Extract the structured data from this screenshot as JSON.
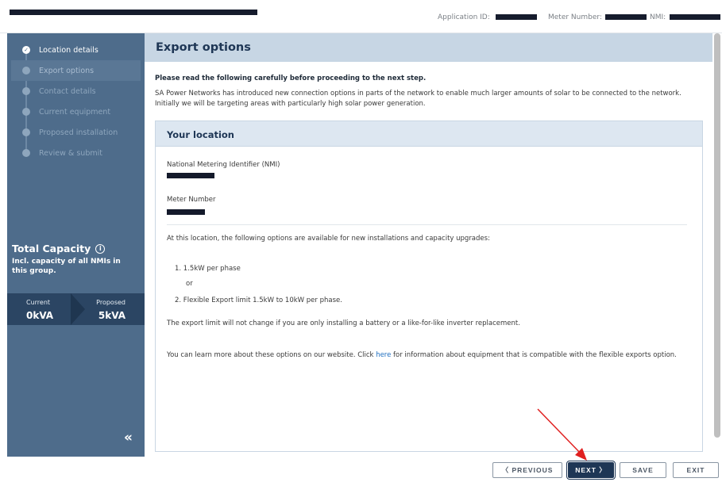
{
  "header": {
    "application_id_label": "Application ID:",
    "meter_number_label": "Meter Number:",
    "nmi_label": "NMI:"
  },
  "sidebar": {
    "steps": [
      {
        "label": "Location details",
        "state": "complete"
      },
      {
        "label": "Export options",
        "state": "current"
      },
      {
        "label": "Contact details",
        "state": "pending"
      },
      {
        "label": "Current equipment",
        "state": "pending"
      },
      {
        "label": "Proposed installation",
        "state": "pending"
      },
      {
        "label": "Review & submit",
        "state": "pending"
      }
    ],
    "capacity": {
      "title": "Total Capacity",
      "subtitle": "Incl. capacity of all NMIs in this group.",
      "current_label": "Current",
      "current_value": "0kVA",
      "proposed_label": "Proposed",
      "proposed_value": "5kVA"
    },
    "collapse_icon": "double-chevron-left-icon"
  },
  "main": {
    "title": "Export options",
    "intro_bold": "Please read the following carefully before proceeding to the next step.",
    "intro": "SA Power Networks has introduced new connection options in parts of the network to enable much larger amounts of solar to be connected to the network. Initially we will be targeting areas with particularly high solar power generation.",
    "card": {
      "title": "Your location",
      "nmi_label": "National Metering Identifier (NMI)",
      "meter_label": "Meter Number",
      "options_intro": "At this location, the following options are available for new installations and capacity upgrades:",
      "option_1": "1. 1.5kW per phase",
      "or_text": "or",
      "option_2": "2. Flexible Export limit 1.5kW to 10kW per phase.",
      "note": "The export limit will not change if you are only installing a battery or a like-for-like inverter replacement.",
      "learn_more_before": "You can learn more about these options on our website. Click ",
      "learn_more_link": "here",
      "learn_more_after": " for information about equipment that is compatible with the flexible exports option."
    }
  },
  "footer": {
    "previous_label": "〈  PREVIOUS",
    "next_label": "NEXT  〉",
    "save_label": "SAVE",
    "exit_label": "EXIT"
  },
  "colors": {
    "sidebar": "#4e6c8b",
    "header_band": "#c7d6e4",
    "primary": "#1e3655",
    "annotation_arrow": "#e02020"
  }
}
